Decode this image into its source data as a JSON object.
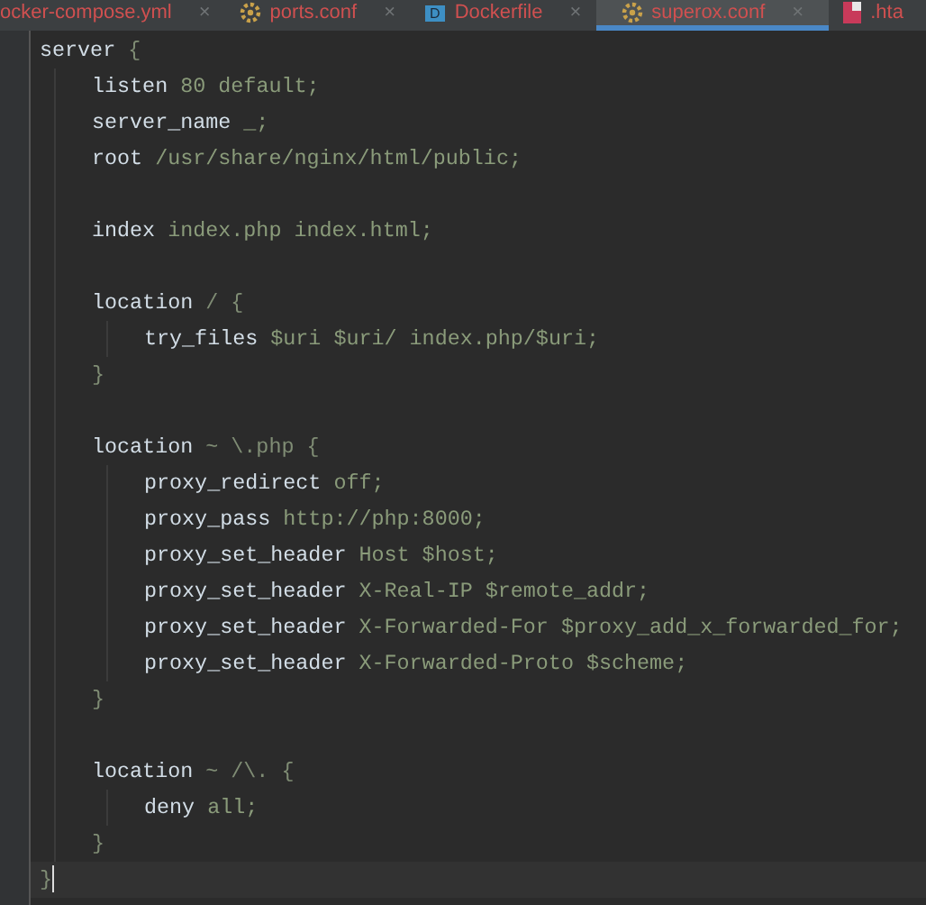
{
  "tabs": [
    {
      "label": "ocker-compose.yml",
      "kind": "plain",
      "close": "×",
      "selected": false
    },
    {
      "label": "ports.conf",
      "kind": "config",
      "close": "×",
      "selected": false
    },
    {
      "label": "Dockerfile",
      "kind": "docker",
      "icon_letter": "D",
      "close": "×",
      "selected": false
    },
    {
      "label": "superox.conf",
      "kind": "config",
      "close": "×",
      "selected": true
    },
    {
      "label": ".hta",
      "kind": "other",
      "selected": false
    }
  ],
  "code": [
    {
      "kind": "block",
      "head": [
        {
          "text": "server",
          "kind": "key"
        },
        {
          "text": " {",
          "kind": "punct"
        }
      ],
      "tail": [
        {
          "text": "}",
          "kind": "punct"
        }
      ],
      "tail_current": true,
      "children": [
        {
          "kind": "line",
          "tokens": [
            {
              "text": "listen",
              "kind": "key"
            },
            {
              "text": " 80 default;",
              "kind": "value"
            }
          ]
        },
        {
          "kind": "line",
          "tokens": [
            {
              "text": "server_name",
              "kind": "key"
            },
            {
              "text": " _;",
              "kind": "value"
            }
          ]
        },
        {
          "kind": "line",
          "tokens": [
            {
              "text": "root",
              "kind": "key"
            },
            {
              "text": " /usr/share/nginx/html/public;",
              "kind": "value"
            }
          ]
        },
        {
          "kind": "blank"
        },
        {
          "kind": "line",
          "tokens": [
            {
              "text": "index",
              "kind": "key"
            },
            {
              "text": " index.php index.html;",
              "kind": "value"
            }
          ]
        },
        {
          "kind": "blank"
        },
        {
          "kind": "block",
          "head": [
            {
              "text": "location",
              "kind": "key"
            },
            {
              "text": " / {",
              "kind": "punct"
            }
          ],
          "tail": [
            {
              "text": "}",
              "kind": "punct"
            }
          ],
          "tail_current": false,
          "children": [
            {
              "kind": "line",
              "tokens": [
                {
                  "text": "try_files",
                  "kind": "key"
                },
                {
                  "text": " $uri $uri/ index.php/$uri;",
                  "kind": "value"
                }
              ]
            }
          ]
        },
        {
          "kind": "blank"
        },
        {
          "kind": "block",
          "head": [
            {
              "text": "location",
              "kind": "key"
            },
            {
              "text": " ~ \\.php {",
              "kind": "punct"
            }
          ],
          "tail": [
            {
              "text": "}",
              "kind": "punct"
            }
          ],
          "tail_current": false,
          "children": [
            {
              "kind": "line",
              "tokens": [
                {
                  "text": "proxy_redirect",
                  "kind": "key"
                },
                {
                  "text": " off;",
                  "kind": "value"
                }
              ]
            },
            {
              "kind": "line",
              "tokens": [
                {
                  "text": "proxy_pass",
                  "kind": "key"
                },
                {
                  "text": " http://php:8000;",
                  "kind": "value"
                }
              ]
            },
            {
              "kind": "line",
              "tokens": [
                {
                  "text": "proxy_set_header",
                  "kind": "key"
                },
                {
                  "text": " Host $host;",
                  "kind": "value"
                }
              ]
            },
            {
              "kind": "line",
              "tokens": [
                {
                  "text": "proxy_set_header",
                  "kind": "key"
                },
                {
                  "text": " X-Real-IP $remote_addr;",
                  "kind": "value"
                }
              ]
            },
            {
              "kind": "line",
              "tokens": [
                {
                  "text": "proxy_set_header",
                  "kind": "key"
                },
                {
                  "text": " X-Forwarded-For $proxy_add_x_forwarded_for;",
                  "kind": "value"
                }
              ]
            },
            {
              "kind": "line",
              "tokens": [
                {
                  "text": "proxy_set_header",
                  "kind": "key"
                },
                {
                  "text": " X-Forwarded-Proto $scheme;",
                  "kind": "value"
                }
              ]
            }
          ]
        },
        {
          "kind": "blank"
        },
        {
          "kind": "block",
          "head": [
            {
              "text": "location",
              "kind": "key"
            },
            {
              "text": " ~ /\\. {",
              "kind": "punct"
            }
          ],
          "tail": [
            {
              "text": "}",
              "kind": "punct"
            }
          ],
          "tail_current": false,
          "children": [
            {
              "kind": "line",
              "tokens": [
                {
                  "text": "deny",
                  "kind": "key"
                },
                {
                  "text": " all;",
                  "kind": "value"
                }
              ]
            }
          ]
        }
      ]
    }
  ]
}
